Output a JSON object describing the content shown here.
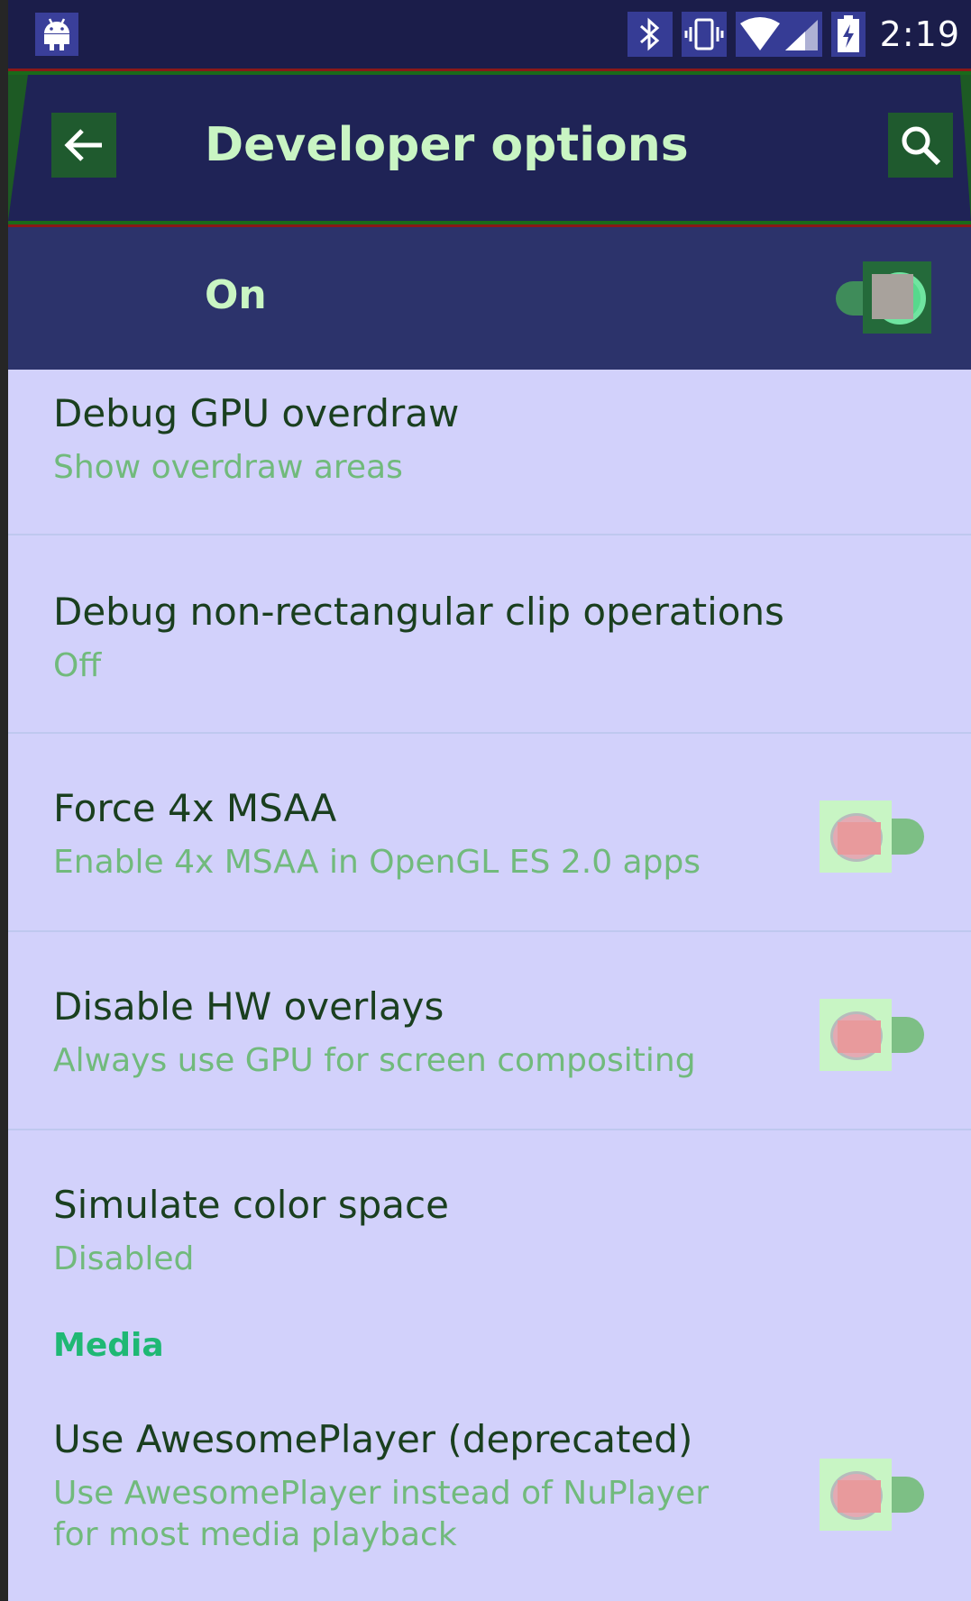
{
  "status_bar": {
    "time": "2:19",
    "icons": [
      "android-notification-icon",
      "bluetooth-icon",
      "vibrate-icon",
      "wifi-icon",
      "cell-signal-icon",
      "battery-charging-icon"
    ]
  },
  "app_bar": {
    "title": "Developer options",
    "back_icon": "arrow-left-icon",
    "search_icon": "search-icon"
  },
  "master_switch": {
    "label": "On",
    "state": "on"
  },
  "items": [
    {
      "title": "Debug GPU overdraw",
      "subtitle": "Show overdraw areas",
      "has_switch": false
    },
    {
      "title": "Debug non-rectangular clip operations",
      "subtitle": "Off",
      "has_switch": false
    },
    {
      "title": "Force 4x MSAA",
      "subtitle": "Enable 4x MSAA in OpenGL ES 2.0 apps",
      "has_switch": true,
      "state": "off"
    },
    {
      "title": "Disable HW overlays",
      "subtitle": "Always use GPU for screen compositing",
      "has_switch": true,
      "state": "off"
    },
    {
      "title": "Simulate color space",
      "subtitle": "Disabled",
      "has_switch": false
    }
  ],
  "section_media": {
    "label": "Media"
  },
  "media_items": [
    {
      "title": "Use AwesomePlayer (deprecated)",
      "subtitle": "Use AwesomePlayer instead of NuPlayer",
      "subtitle_line2": "for most media playback",
      "has_switch": true,
      "state": "off"
    }
  ],
  "colors": {
    "status_bar_bg": "#1b1d4a",
    "app_bar_bg": "#1f2356",
    "master_bar_bg": "#2c336b",
    "list_bg": "#d2d1fb",
    "title_text": "#c9f5c3",
    "item_title": "#1a3f1f",
    "item_subtitle": "#71ba7c",
    "section_accent": "#1fb874"
  }
}
